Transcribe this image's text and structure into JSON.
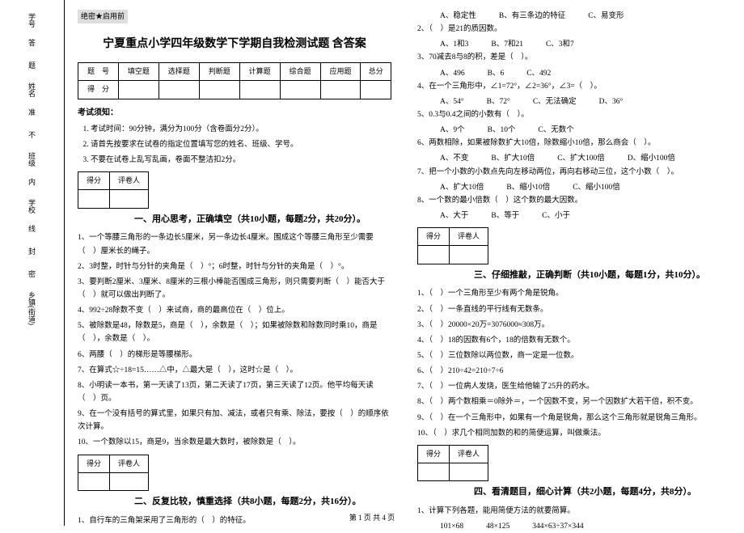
{
  "binding": {
    "fields": [
      "学号",
      "姓名",
      "班级",
      "学校",
      "乡镇(街道)"
    ],
    "zones": [
      "答",
      "题",
      "准",
      "不",
      "内",
      "线",
      "封",
      "密"
    ]
  },
  "secret": "绝密★启用前",
  "title": "宁夏重点小学四年级数学下学期自我检测试题 含答案",
  "header_table": {
    "row1": [
      "题　号",
      "填空题",
      "选择题",
      "判断题",
      "计算题",
      "综合题",
      "应用题",
      "总分"
    ],
    "row2": [
      "得　分",
      "",
      "",
      "",
      "",
      "",
      "",
      ""
    ]
  },
  "notice_title": "考试须知：",
  "notice": [
    "考试时间：90分钟，满分为100分（含卷面分2分）。",
    "请首先按要求在试卷的指定位置填写您的姓名、班级、学号。",
    "不要在试卷上乱写乱画，卷面不整洁扣2分。"
  ],
  "score_cells": [
    "得分",
    "评卷人"
  ],
  "s1": {
    "heading": "一、用心思考，正确填空（共10小题，每题2分，共20分）。",
    "q": [
      "1、一个等腰三角形的一条边长5厘米，另一条边长4厘米。围成这个等腰三角形至少需要（　）厘米长的绳子。",
      "2、3时整，时针与分针的夹角是（　）°；6时整，时针与分针的夹角是（　）°。",
      "3、要判断2厘米、3厘米、8厘米的三根小棒能否围成三角形，则只需要判断（　）能否大于（　）就可以做出判断了。",
      "4、992÷28除数不变（　）来试商，商的最高位在（　）位上。",
      "5、被除数是48，除数是5，商是（　），余数是（　）；如果被除数和除数同时乘10，商是（　），余数是（　）。",
      "6、两腰（　）的梯形是等腰梯形。",
      "7、在算式☆÷18=15……△中，△最大是（　），这时☆是（　）。",
      "8、小明读一本书，第一天读了13页，第二天读了17页，第三天读了12页。他平均每天读（　）页。",
      "9、在一个没有括号的算式里，如果只有加、减法，或者只有乘、除法，要按（　）的顺序依次计算。",
      "10、一个数除以15，商是9，当余数是最大数时，被除数是（　）。"
    ]
  },
  "s2": {
    "heading": "二、反复比较，慎重选择（共8小题，每题2分，共16分）。",
    "q": [
      {
        "text": "1、自行车的三角架采用了三角形的（　）的特征。",
        "opts": [
          "A、稳定性",
          "B、有三条边的特征",
          "C、易变形"
        ]
      },
      {
        "text": "2、（　）是21的质因数。",
        "opts": [
          "A、1和3",
          "B、7和21",
          "C、3和7"
        ]
      },
      {
        "text": "3、70减去8与8的积，差是（　）。",
        "opts": [
          "A、496",
          "B、6",
          "C、492"
        ]
      },
      {
        "text": "4、在一个三角形中，∠1=72°，∠2=36°，∠3=（　）。",
        "opts": [
          "A、54°",
          "B、72°",
          "C、无法确定",
          "D、36°"
        ]
      },
      {
        "text": "5、0.3与0.4之间的小数有（　）。",
        "opts": [
          "A、9个",
          "B、10个",
          "C、无数个"
        ]
      },
      {
        "text": "6、两数相除，如果被除数扩大10倍，除数缩小10倍，那么商会（　）。",
        "opts": [
          "A、不变",
          "B、扩大10倍",
          "C、扩大100倍",
          "D、缩小100倍"
        ]
      },
      {
        "text": "7、把一个小数的小数点先向左移动两位，再向右移动三位，这个小数（　）。",
        "opts": [
          "A、扩大10倍",
          "B、缩小10倍",
          "C、缩小100倍"
        ]
      },
      {
        "text": "8、一个数的最小倍数（　）这个数的最大因数。",
        "opts": [
          "A、大于",
          "B、等于",
          "C、小于"
        ]
      }
    ]
  },
  "s3": {
    "heading": "三、仔细推敲，正确判断（共10小题，每题1分，共10分）。",
    "q": [
      "1、（　）一个三角形至少有两个角是锐角。",
      "2、（　）一条直线的平行线有无数条。",
      "3、（　）20000×20万=3076000≈308万。",
      "4、（　）18的因数有6个，18的倍数有无数个。",
      "5、（　）三位数除以两位数，商一定是一位数。",
      "6、（　）210÷42=210÷7÷6",
      "7、（　）一位病人发烧，医生给他输了25升的药水。",
      "8、（　）两个数相乘＝0除外＝，一个因数不变，另一个因数扩大若干倍，积不变。",
      "9、（　）在一个三角形中，如果有一个角是锐角，那么这个三角形就是锐角三角形。",
      "10、（　）求几个相同加数的和的简便运算，叫做乘法。"
    ]
  },
  "s4": {
    "heading": "四、看清题目，细心计算（共2小题，每题4分，共8分）。",
    "q1_text": "1、计算下列各题，能用简便方法的就要简算。",
    "q1_expr": [
      "101×68",
      "48×125",
      "344×63÷37×344"
    ]
  },
  "footer": "第 1 页 共 4 页"
}
